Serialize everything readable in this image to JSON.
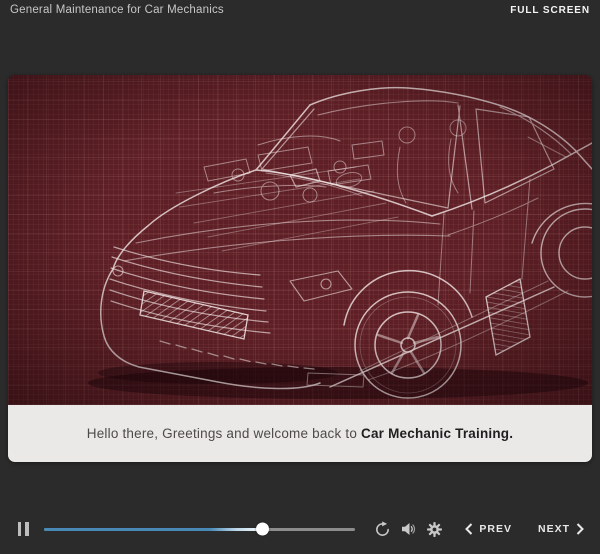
{
  "header": {
    "title": "General Maintenance for Car Mechanics",
    "full_screen_label": "FULL SCREEN"
  },
  "slide": {
    "illustration_name": "car-blueprint-xray-wireframe",
    "background_color": "#5e2026",
    "line_color": "#f2e6e6",
    "caption": {
      "text_regular": "Hello there, Greetings and welcome back to ",
      "text_bold": "Car Mechanic Training."
    }
  },
  "player": {
    "progress_percent": 70,
    "seekbar_colors": {
      "fill": "#4889b6",
      "track": "#8d8d8d",
      "handle": "#ffffff"
    },
    "icons": [
      "pause-icon",
      "replay-icon",
      "volume-icon",
      "settings-gear-icon",
      "chevron-left-icon",
      "chevron-right-icon"
    ],
    "prev_label": "PREV",
    "next_label": "NEXT"
  }
}
